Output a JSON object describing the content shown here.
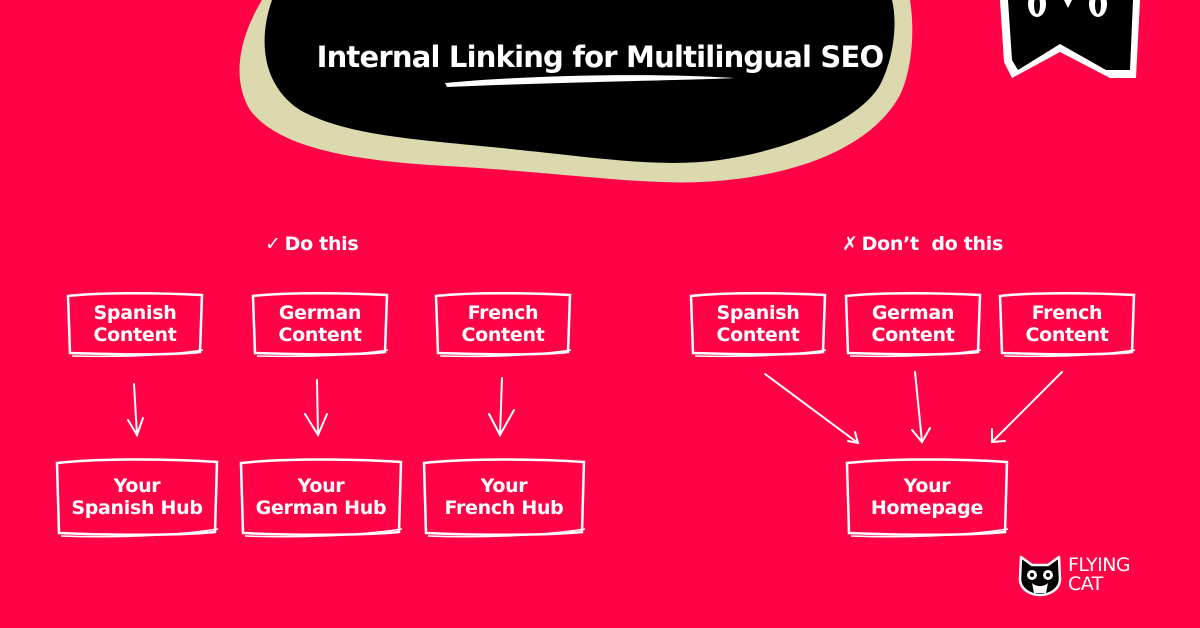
{
  "colors": {
    "background": "#ff0347",
    "blob": "#000000",
    "blob_shadow": "#ddd9ae",
    "foreground": "#ffffff"
  },
  "header": {
    "title_part1": "Internal ",
    "title_part2": "Linking for Multilingual",
    "title_part3": " SEO"
  },
  "do_section": {
    "icon": "check-icon",
    "label": "Do this",
    "sources": [
      {
        "label": "Spanish\nContent"
      },
      {
        "label": "German\nContent"
      },
      {
        "label": "French\nContent"
      }
    ],
    "targets": [
      {
        "label": "Your\nSpanish Hub"
      },
      {
        "label": "Your\nGerman Hub"
      },
      {
        "label": "Your\nFrench Hub"
      }
    ]
  },
  "dont_section": {
    "icon": "cross-icon",
    "label": "Don’t  do this",
    "sources": [
      {
        "label": "Spanish\nContent"
      },
      {
        "label": "German\nContent"
      },
      {
        "label": "French\nContent"
      }
    ],
    "target": {
      "label": "Your\nHomepage"
    }
  },
  "brand": {
    "name": "FLYING\nCAT",
    "logo_icon": "cat-head-icon"
  }
}
